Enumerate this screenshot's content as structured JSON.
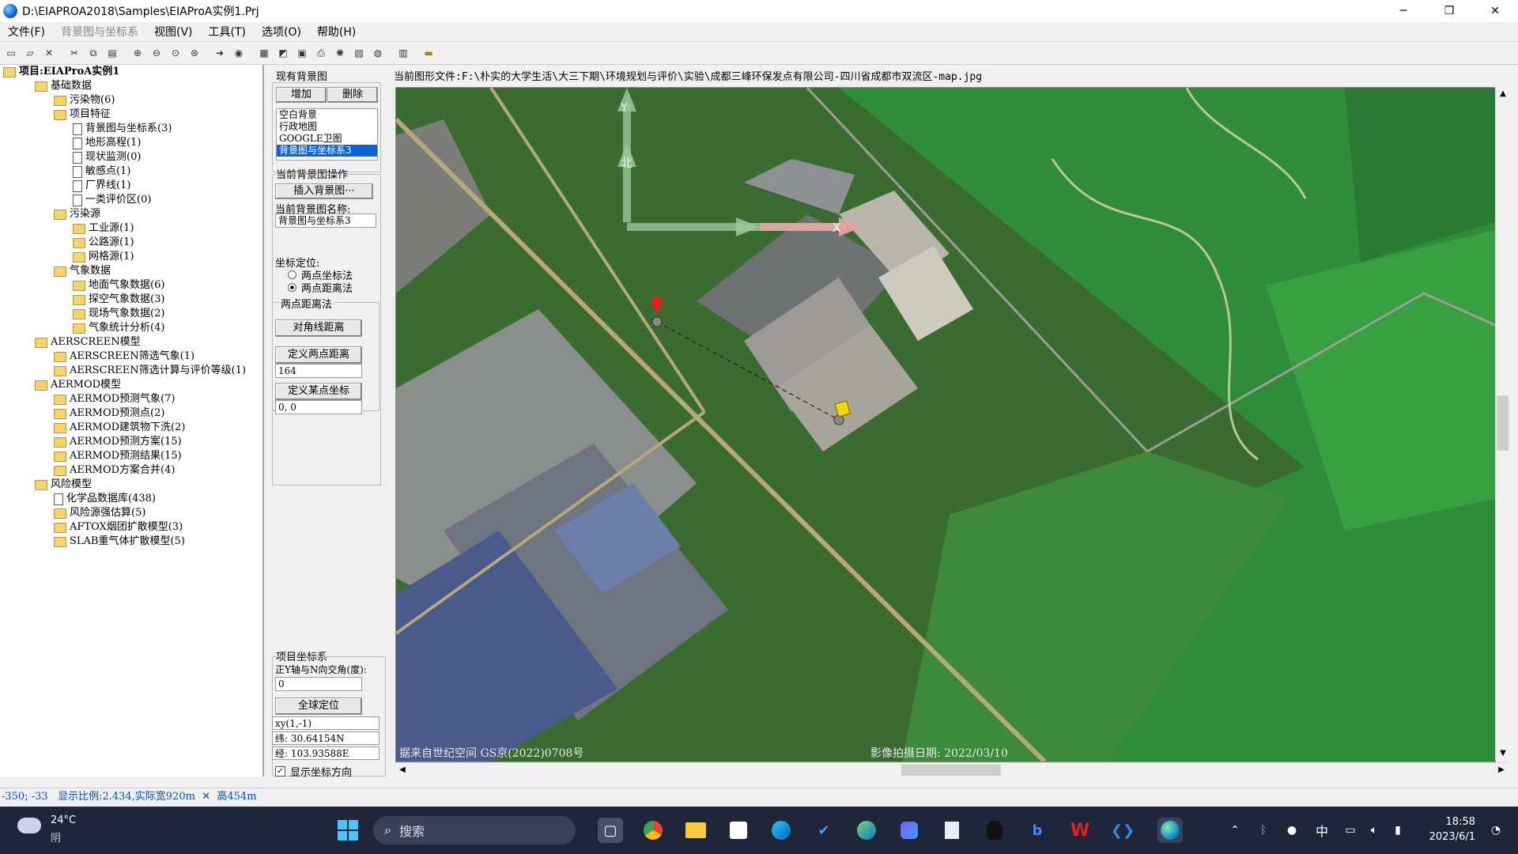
{
  "window": {
    "title": "D:\\EIAPROA2018\\Samples\\EIAProA实例1.Prj",
    "controls": [
      "─",
      "❐",
      "✕"
    ]
  },
  "menu": [
    {
      "label": "文件(F)",
      "enabled": true
    },
    {
      "label": "背景图与坐标系",
      "enabled": false
    },
    {
      "label": "视图(V)",
      "enabled": true
    },
    {
      "label": "工具(T)",
      "enabled": true
    },
    {
      "label": "选项(O)",
      "enabled": true
    },
    {
      "label": "帮助(H)",
      "enabled": true
    }
  ],
  "tree": {
    "root": "项目:EIAProA实例1",
    "items": [
      {
        "label": "基础数据",
        "type": "folder",
        "level": 1
      },
      {
        "label": "污染物(6)",
        "type": "folder",
        "level": 2
      },
      {
        "label": "项目特征",
        "type": "folder",
        "level": 2
      },
      {
        "label": "背景图与坐标系(3)",
        "type": "doc",
        "level": 3
      },
      {
        "label": "地形高程(1)",
        "type": "doc",
        "level": 3
      },
      {
        "label": "现状监测(0)",
        "type": "doc",
        "level": 3
      },
      {
        "label": "敏感点(1)",
        "type": "doc",
        "level": 3
      },
      {
        "label": "厂界线(1)",
        "type": "doc",
        "level": 3
      },
      {
        "label": "一类评价区(0)",
        "type": "doc",
        "level": 3
      },
      {
        "label": "污染源",
        "type": "folder",
        "level": 2
      },
      {
        "label": "工业源(1)",
        "type": "folder",
        "level": 3
      },
      {
        "label": "公路源(1)",
        "type": "folder",
        "level": 3
      },
      {
        "label": "网格源(1)",
        "type": "folder",
        "level": 3
      },
      {
        "label": "气象数据",
        "type": "folder",
        "level": 2
      },
      {
        "label": "地面气象数据(6)",
        "type": "folder",
        "level": 3
      },
      {
        "label": "探空气象数据(3)",
        "type": "folder",
        "level": 3
      },
      {
        "label": "现场气象数据(2)",
        "type": "folder",
        "level": 3
      },
      {
        "label": "气象统计分析(4)",
        "type": "folder",
        "level": 3
      },
      {
        "label": "AERSCREEN模型",
        "type": "folder",
        "level": 1
      },
      {
        "label": "AERSCREEN筛选气象(1)",
        "type": "folder",
        "level": 2
      },
      {
        "label": "AERSCREEN筛选计算与评价等级(1)",
        "type": "folder",
        "level": 2
      },
      {
        "label": "AERMOD模型",
        "type": "folder",
        "level": 1
      },
      {
        "label": "AERMOD预测气象(7)",
        "type": "folder",
        "level": 2
      },
      {
        "label": "AERMOD预测点(2)",
        "type": "folder",
        "level": 2
      },
      {
        "label": "AERMOD建筑物下洗(2)",
        "type": "folder",
        "level": 2
      },
      {
        "label": "AERMOD预测方案(15)",
        "type": "folder",
        "level": 2
      },
      {
        "label": "AERMOD预测结果(15)",
        "type": "folder",
        "level": 2
      },
      {
        "label": "AERMOD方案合并(4)",
        "type": "folder",
        "level": 2
      },
      {
        "label": "风险模型",
        "type": "folder",
        "level": 1
      },
      {
        "label": "化学品数据库(438)",
        "type": "doc",
        "level": 2
      },
      {
        "label": "风险源强估算(5)",
        "type": "folder",
        "level": 2
      },
      {
        "label": "AFTOX烟团扩散模型(3)",
        "type": "folder",
        "level": 2
      },
      {
        "label": "SLAB重气体扩散模型(5)",
        "type": "folder",
        "level": 2
      }
    ]
  },
  "panel": {
    "existing_title": "现有背景图",
    "add_button": "增加",
    "delete_button": "删除",
    "bg_list": [
      "空白背景",
      "行政地图",
      "GOOGLE卫图",
      "背景图与坐标系3"
    ],
    "bg_selected_index": 3,
    "current_ops_title": "当前背景图操作",
    "insert_button": "插入背景图···",
    "current_name_label": "当前背景图名称:",
    "current_name_value": "背景图与坐标系3",
    "coord_locate_label": "坐标定位:",
    "radio_two_coords": "两点坐标法",
    "radio_two_dist": "两点距离法",
    "radio_selected": "two_dist",
    "two_dist_group": "两点距离法",
    "diagonal_button": "对角线距离",
    "define_dist_button": "定义两点距离",
    "dist_value": "164",
    "define_point_button": "定义某点坐标",
    "point_value": "0, 0",
    "proj_coord_title": "项目坐标系",
    "angle_label": "正Y轴与N向交角(度):",
    "angle_value": "0",
    "global_locate_button": "全球定位",
    "xy_value": "xy(1,-1)",
    "lat_value": "纬: 30.64154N",
    "lon_value": "经: 103.93588E",
    "show_dir_label": "显示坐标方向",
    "show_dir_checked": true
  },
  "map": {
    "current_file_label": "当前图形文件:F:\\朴实的大学生活\\大三下期\\环境规划与评价\\实验\\成都三峰环保发点有限公司-四川省成都市双流区-map.jpg",
    "axis_y": "Y",
    "axis_x": "X",
    "axis_north": "北",
    "watermark_left": "据来自世纪空间 GS京(2022)0708号",
    "watermark_right": "影像拍摄日期: 2022/03/10"
  },
  "status": {
    "coords": "-350; -33",
    "scale": "显示比例:2.434,实际宽920m",
    "cross": "✕",
    "height": "高454m"
  },
  "taskbar": {
    "weather_temp": "24°C",
    "weather_desc": "阴",
    "search_placeholder": "搜索",
    "ime": "中",
    "time": "18:58",
    "date": "2023/6/1"
  }
}
